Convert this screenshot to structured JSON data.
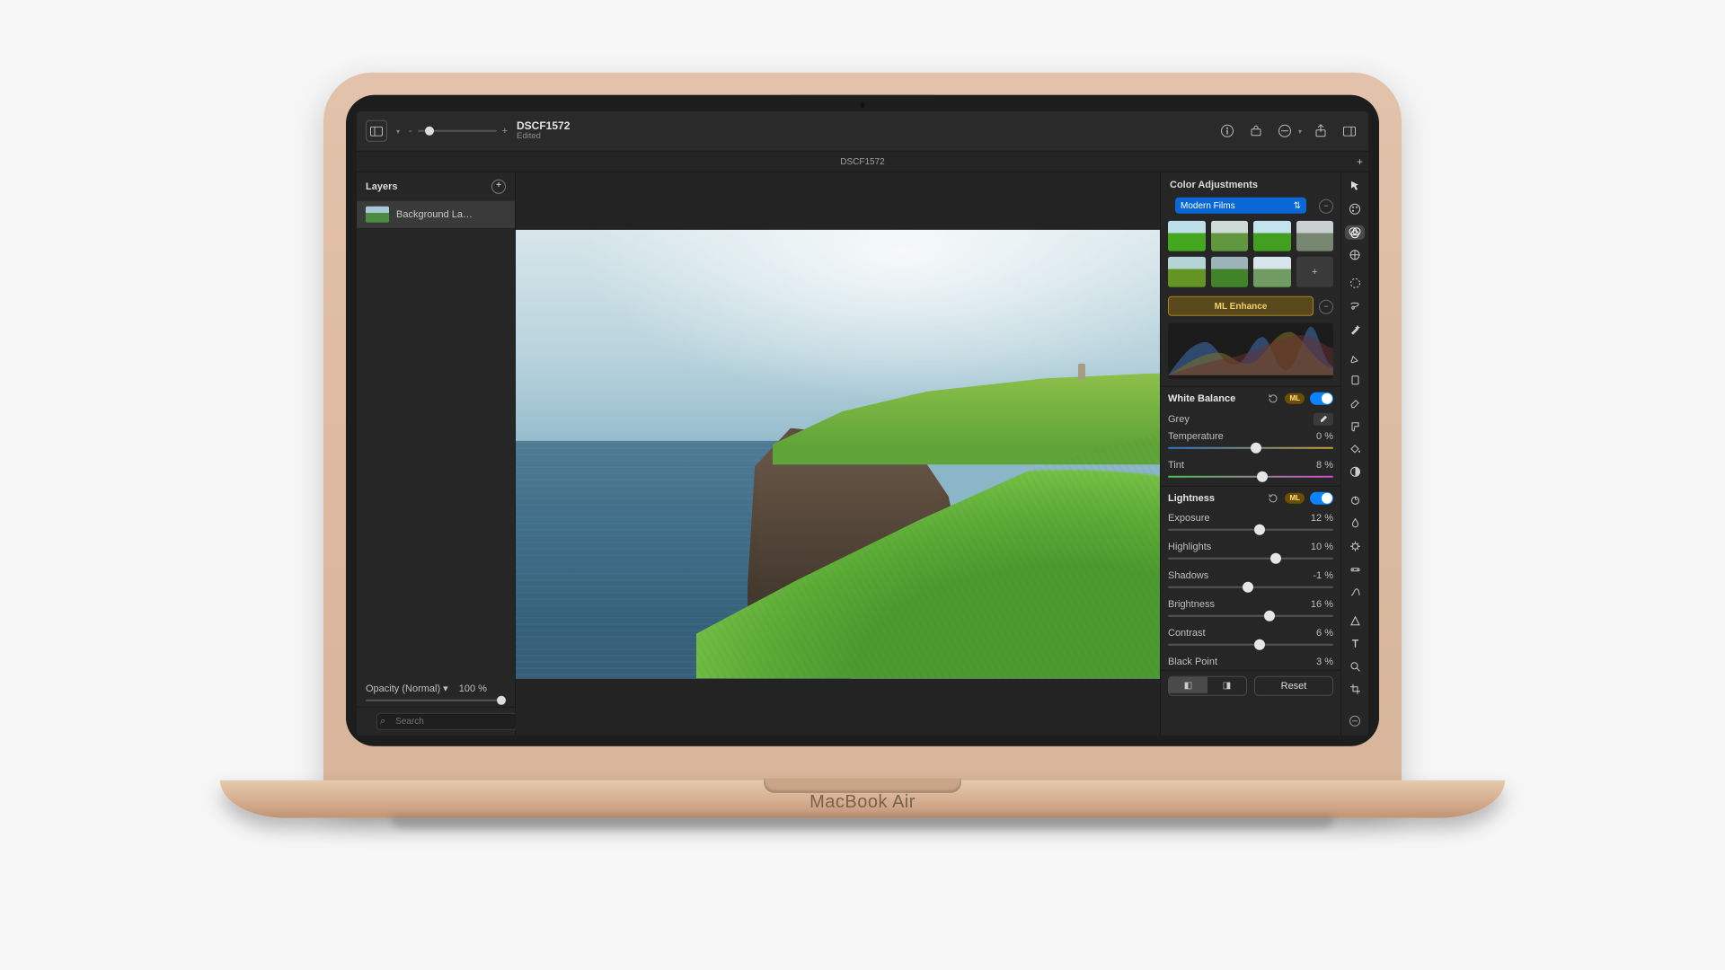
{
  "device_brand": "MacBook Air",
  "topbar": {
    "file_name": "DSCF1572",
    "status": "Edited",
    "zoom_minus": "-",
    "zoom_plus": "+"
  },
  "tabstrip": {
    "tab_label": "DSCF1572",
    "add_label": "+"
  },
  "sidebar": {
    "heading": "Layers",
    "add_label": "+",
    "layer_name": "Background La…",
    "opacity_label": "Opacity (Normal) ▾",
    "opacity_value": "100 %",
    "search_placeholder": "Search",
    "filter_label": "⋯"
  },
  "inspector": {
    "heading": "Color Adjustments",
    "preset_label": "Modern Films",
    "preset_remove": "−",
    "thumb_add": "+",
    "ml_button": "ML Enhance",
    "ml_remove": "−",
    "white_balance": {
      "title": "White Balance",
      "ml": "ML"
    },
    "grey_label": "Grey",
    "temperature": {
      "label": "Temperature",
      "value": "0 %",
      "pos": 50
    },
    "tint": {
      "label": "Tint",
      "value": "8 %",
      "pos": 54
    },
    "lightness": {
      "title": "Lightness",
      "ml": "ML"
    },
    "exposure": {
      "label": "Exposure",
      "value": "12 %",
      "pos": 52
    },
    "highlights": {
      "label": "Highlights",
      "value": "10 %",
      "pos": 62
    },
    "shadows": {
      "label": "Shadows",
      "value": "-1 %",
      "pos": 45
    },
    "brightness": {
      "label": "Brightness",
      "value": "16 %",
      "pos": 58
    },
    "contrast": {
      "label": "Contrast",
      "value": "6 %",
      "pos": 52
    },
    "black_point": {
      "label": "Black Point",
      "value": "3 %"
    },
    "compare_a": "◧",
    "compare_b": "◨",
    "reset": "Reset"
  },
  "tools": {
    "arrow": "Arrange",
    "style": "Style",
    "adjust": "Color Adjust",
    "effects": "Effects",
    "retouch": "Retouch",
    "marquee": "Marquee",
    "lasso": "Lasso",
    "wand": "Magic Wand",
    "pen": "Pen",
    "brush": "Brush",
    "erase": "Eraser",
    "paint": "Paint",
    "fill": "Fill",
    "gradient": "Gradient",
    "clone": "Clone",
    "smudge": "Smudge",
    "sharpen": "Sharpen",
    "repair": "Repair",
    "shape": "Shape",
    "type": "Type",
    "zoom": "Zoom",
    "crop": "Crop",
    "hide": "−"
  }
}
